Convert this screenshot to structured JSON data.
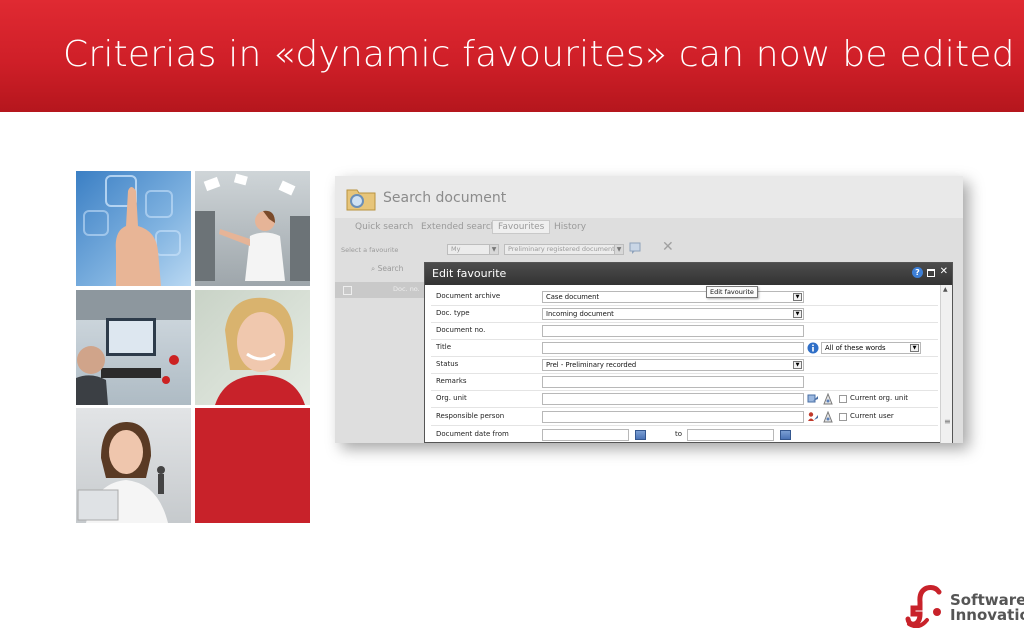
{
  "slide": {
    "title": "Criterias in «dynamic favourites» can now be edited"
  },
  "photos": [
    "finger-touch-photo",
    "office-woman-papers-photo",
    "person-computer-photo",
    "smiling-woman-photo",
    "woman-thinking-photo",
    "red-block"
  ],
  "search_document": {
    "title": "Search document",
    "tabs": [
      {
        "label": "Quick search"
      },
      {
        "label": "Extended search"
      },
      {
        "label": "Favourites",
        "active": true
      },
      {
        "label": "History"
      }
    ],
    "favourite_label": "Select a favourite",
    "owner_select": "My",
    "favourite_select": "Preliminary registered documents",
    "search_button": "Search",
    "grid_column": "Doc. no."
  },
  "dialog": {
    "title": "Edit favourite",
    "tooltip": "Edit favourite",
    "rows": [
      {
        "label": "Document archive",
        "value": "Case document"
      },
      {
        "label": "Doc. type",
        "value": "Incoming document"
      },
      {
        "label": "Document no.",
        "value": ""
      },
      {
        "label": "Title",
        "value": "",
        "match_option": "All of these words"
      },
      {
        "label": "Status",
        "value": "Prel - Preliminary recorded"
      },
      {
        "label": "Remarks",
        "value": ""
      },
      {
        "label": "Org. unit",
        "value": "",
        "checkbox_label": "Current org. unit"
      },
      {
        "label": "Responsible person",
        "value": "",
        "checkbox_label": "Current user"
      },
      {
        "label": "Document date from",
        "to_label": "to"
      }
    ]
  },
  "logo": {
    "line1": "Software",
    "line2": "Innovation",
    "color": "#c8222a"
  },
  "colors": {
    "banner": "#d0202a",
    "dialog_bar": "#3a3a3a"
  }
}
